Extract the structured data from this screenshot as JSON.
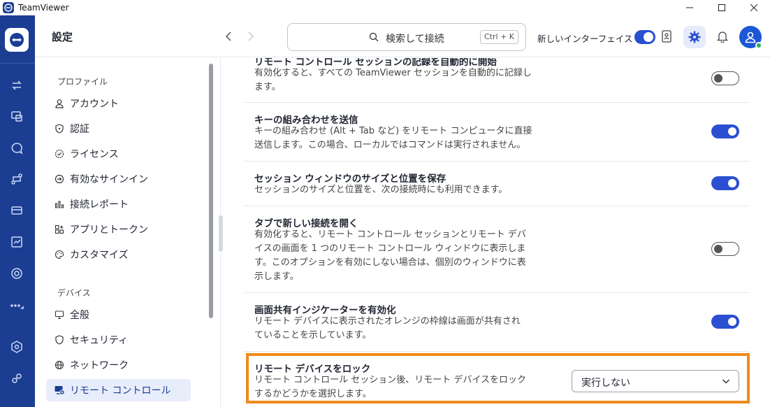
{
  "window": {
    "title": "TeamViewer"
  },
  "header": {
    "page_title": "設定",
    "search_placeholder": "検索して接続",
    "search_shortcut": "Ctrl + K",
    "new_ui_label": "新しいインターフェイス"
  },
  "sidebar": {
    "sections": [
      {
        "label": "プロファイル"
      },
      {
        "label": "デバイス"
      }
    ],
    "items": [
      {
        "label": "アカウント",
        "icon": "person-icon"
      },
      {
        "label": "認証",
        "icon": "shield-icon"
      },
      {
        "label": "ライセンス",
        "icon": "badge-check-icon"
      },
      {
        "label": "有効なサインイン",
        "icon": "signin-icon"
      },
      {
        "label": "接続レポート",
        "icon": "bar-chart-icon"
      },
      {
        "label": "アプリとトークン",
        "icon": "apps-icon"
      },
      {
        "label": "カスタマイズ",
        "icon": "palette-icon"
      },
      {
        "label": "全般",
        "icon": "monitor-icon"
      },
      {
        "label": "セキュリティ",
        "icon": "shield-icon"
      },
      {
        "label": "ネットワーク",
        "icon": "globe-icon"
      },
      {
        "label": "リモート コントロール",
        "icon": "remote-control-icon",
        "active": true
      }
    ]
  },
  "settings": [
    {
      "title": "リモート コントロール セッションの記録を自動的に開始",
      "desc": "有効化すると、すべての TeamViewer セッションを自動的に記録し\nます。",
      "enabled": false
    },
    {
      "title": "キーの組み合わせを送信",
      "desc": "キーの組み合わせ (Alt + Tab など) をリモート コンピュータに直接\n送信します。この場合、ローカルではコマンドは実行されません。",
      "enabled": true
    },
    {
      "title": "セッション ウィンドウのサイズと位置を保存",
      "desc": "セッションのサイズと位置を、次の接続時にも利用できます。",
      "enabled": true
    },
    {
      "title": "タブで新しい接続を開く",
      "desc": "有効化すると、リモート コントロール セッションとリモート デバ\nイスの画面を 1 つのリモート コントロール ウィンドウに表示しま\nす。このオプションを有効にしない場合は、個別のウィンドウに表\n示します。",
      "enabled": false
    },
    {
      "title": "画面共有インジケーターを有効化",
      "desc": "リモート デバイスに表示されたオレンジの枠線は画面が共有され\nていることを示しています。",
      "enabled": true
    },
    {
      "title": "リモート デバイスをロック",
      "desc": "リモート コントロール セッション後、リモート デバイスをロック\nするかどうかを選択します。",
      "select_value": "実行しない"
    }
  ],
  "colors": {
    "rail": "#1b3e93",
    "accent": "#2b4fd1",
    "highlight": "#f08a1c"
  }
}
